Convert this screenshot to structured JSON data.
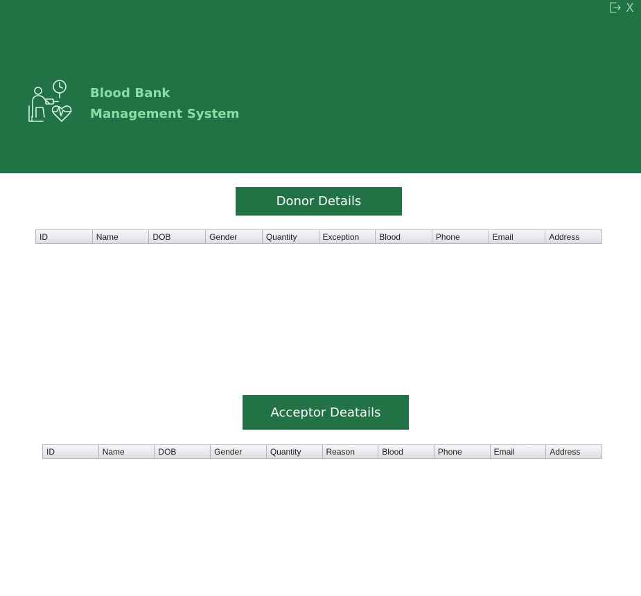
{
  "window": {
    "close_label": "X",
    "exit_icon": "exit-icon"
  },
  "header": {
    "logo_icon": "blood-donor-icon",
    "title_line1": "Blood Bank",
    "title_line2": "Management System",
    "background_color": "#217346",
    "title_color": "#86e0a3"
  },
  "donor_section": {
    "button_label": "Donor Details",
    "columns": [
      "ID",
      "Name",
      "DOB",
      "Gender",
      "Quantity",
      "Exception",
      "Blood",
      "Phone",
      "Email",
      "Address"
    ],
    "rows": []
  },
  "acceptor_section": {
    "button_label": "Acceptor Deatails",
    "columns": [
      "ID",
      "Name",
      "DOB",
      "Gender",
      "Quantity",
      "Reason",
      "Blood",
      "Phone",
      "Email",
      "Address"
    ],
    "rows": []
  }
}
